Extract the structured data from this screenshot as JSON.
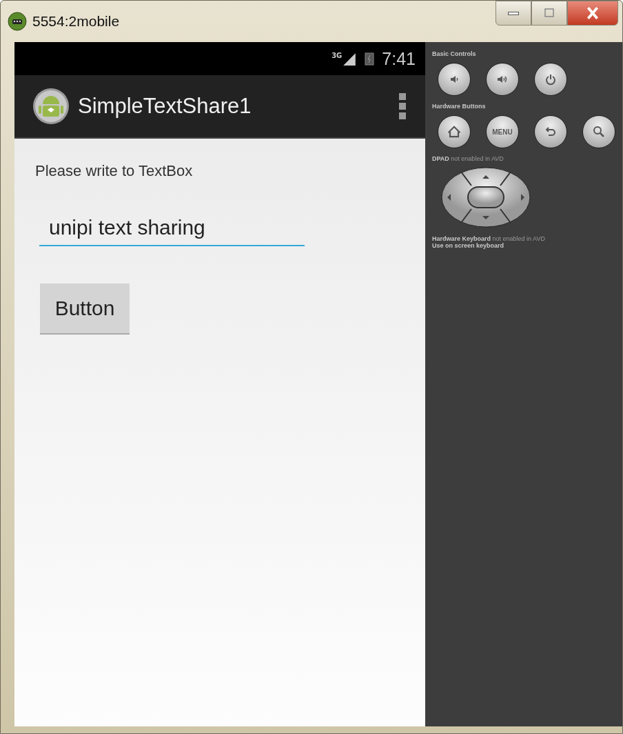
{
  "window": {
    "title": "5554:2mobile"
  },
  "status_bar": {
    "network": "3G",
    "time": "7:41"
  },
  "action_bar": {
    "title": "SimpleTextShare1"
  },
  "content": {
    "prompt": "Please write to TextBox",
    "text_field": {
      "value": "unipi text sharing",
      "focused": true
    },
    "button": "Button"
  },
  "controls": {
    "basic_title": "Basic Controls",
    "hardware_title": "Hardware Buttons",
    "menu_label": "MENU",
    "dpad_note": "**DPAD** not enabled in AVD",
    "keyboard_note": "**Hardware Keyboard** not enabled in AVD",
    "keyboard_hint": "Use on screen keyboard"
  }
}
